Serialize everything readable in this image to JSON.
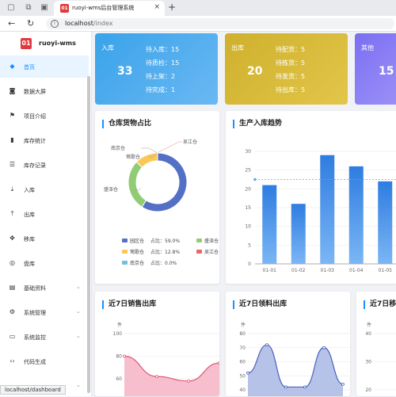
{
  "browser": {
    "tab_favicon": "01",
    "tab_title": "ruoyi-wms后台管理系统",
    "address_host": "localhost",
    "address_path": "/index",
    "status_url": "localhost/dashboard"
  },
  "app": {
    "logo_mark": "01",
    "name": "ruoyi-wms"
  },
  "sidebar": {
    "items": [
      {
        "label": "首页",
        "icon": "dashboard-icon",
        "glyph": "◆",
        "active": true,
        "has_children": false
      },
      {
        "label": "数据大屏",
        "icon": "screen-icon",
        "glyph": "◙",
        "active": false,
        "has_children": false
      },
      {
        "label": "项目介绍",
        "icon": "guide-icon",
        "glyph": "⚑",
        "active": false,
        "has_children": false
      },
      {
        "label": "库存统计",
        "icon": "bar-chart-icon",
        "glyph": "▮",
        "active": false,
        "has_children": false
      },
      {
        "label": "库存记录",
        "icon": "list-icon",
        "glyph": "☰",
        "active": false,
        "has_children": false
      },
      {
        "label": "入库",
        "icon": "inbound-icon",
        "glyph": "⤓",
        "active": false,
        "has_children": false
      },
      {
        "label": "出库",
        "icon": "outbound-icon",
        "glyph": "⤒",
        "active": false,
        "has_children": false
      },
      {
        "label": "移库",
        "icon": "move-icon",
        "glyph": "✥",
        "active": false,
        "has_children": false
      },
      {
        "label": "盘库",
        "icon": "check-icon",
        "glyph": "◎",
        "active": false,
        "has_children": false
      },
      {
        "label": "基础资料",
        "icon": "book-icon",
        "glyph": "▤",
        "active": false,
        "has_children": true
      },
      {
        "label": "系统管理",
        "icon": "gear-icon",
        "glyph": "⚙",
        "active": false,
        "has_children": true
      },
      {
        "label": "系统监控",
        "icon": "monitor-icon",
        "glyph": "▭",
        "active": false,
        "has_children": true
      },
      {
        "label": "代码生成",
        "icon": "code-icon",
        "glyph": "‹›",
        "active": false,
        "has_children": false
      },
      {
        "label": "",
        "icon": "more-icon",
        "glyph": "",
        "active": false,
        "has_children": true
      }
    ]
  },
  "stats": {
    "inbound": {
      "title": "入库",
      "total": "33",
      "lines": [
        "待入库：15",
        "待质检：15",
        "待上架：2",
        "待完成：1"
      ],
      "colors": [
        "#3aa3ea",
        "#6ab8f2"
      ]
    },
    "outbound": {
      "title": "出库",
      "total": "20",
      "lines": [
        "待配货：5",
        "待拣货：5",
        "待发货：5",
        "待出库：5"
      ],
      "colors": [
        "#cfb02d",
        "#e2c64a"
      ]
    },
    "other": {
      "title": "其他",
      "total": "15",
      "lines": [],
      "colors": [
        "#7b6ff2",
        "#9a8ff7"
      ]
    }
  },
  "panels": {
    "donut_title": "仓库货物占比",
    "trend_title": "生产入库趋势",
    "sales_title": "近7日销售出库",
    "material_title": "近7日领料出库",
    "third_title": "近7日移"
  },
  "chart_data": [
    {
      "type": "pie",
      "title": "仓库货物占比",
      "slices": [
        {
          "name": "园区仓",
          "value": 59.0,
          "color": "#5470c6"
        },
        {
          "name": "盛泽仓",
          "value": 28.2,
          "color": "#91cc75"
        },
        {
          "name": "莺歌仓",
          "value": 12.8,
          "color": "#fac858"
        },
        {
          "name": "吴江仓",
          "value": 0.0,
          "color": "#ee6666"
        },
        {
          "name": "南京仓",
          "value": 0.0,
          "color": "#73c0de"
        }
      ],
      "legend": [
        {
          "name": "园区仓",
          "pct_text": "占比：59.0%",
          "color": "#5470c6"
        },
        {
          "name": "盛泽仓",
          "pct_text": "占",
          "color": "#91cc75"
        },
        {
          "name": "莺歌仓",
          "pct_text": "占比：12.8%",
          "color": "#fac858"
        },
        {
          "name": "吴江仓",
          "pct_text": "占",
          "color": "#ee6666"
        },
        {
          "name": "南京仓",
          "pct_text": "占比：0.0%",
          "color": "#73c0de"
        }
      ],
      "slice_labels": [
        "莺歌仓",
        "盛泽仓",
        "南京仓",
        "吴江仓"
      ]
    },
    {
      "type": "bar",
      "title": "生产入库趋势",
      "categories": [
        "01-01",
        "01-02",
        "01-03",
        "01-04",
        "01-05"
      ],
      "values": [
        21,
        16,
        29,
        26,
        22
      ],
      "ylim": [
        0,
        30
      ],
      "yticks": [
        0,
        5,
        10,
        15,
        20,
        25,
        30
      ],
      "mark_line": 22.5,
      "bar_color": "#2e7de1",
      "bar_color_light": "#7bb6f5"
    },
    {
      "type": "area",
      "title": "近7日销售出库",
      "ylabel": "件",
      "ylim": [
        60,
        100
      ],
      "yticks": [
        60,
        80,
        100
      ],
      "color": "#e0577a",
      "fill": "#f6b3c4"
    },
    {
      "type": "area",
      "title": "近7日领料出库",
      "ylabel": "件",
      "ylim": [
        40,
        80
      ],
      "yticks": [
        40,
        50,
        60,
        70,
        80
      ],
      "color": "#4a63b8",
      "fill": "#aab7e4"
    },
    {
      "type": "line",
      "title": "近7日移",
      "ylabel": "件",
      "ylim": [
        20,
        40
      ],
      "yticks": [
        20,
        30,
        40
      ]
    }
  ]
}
